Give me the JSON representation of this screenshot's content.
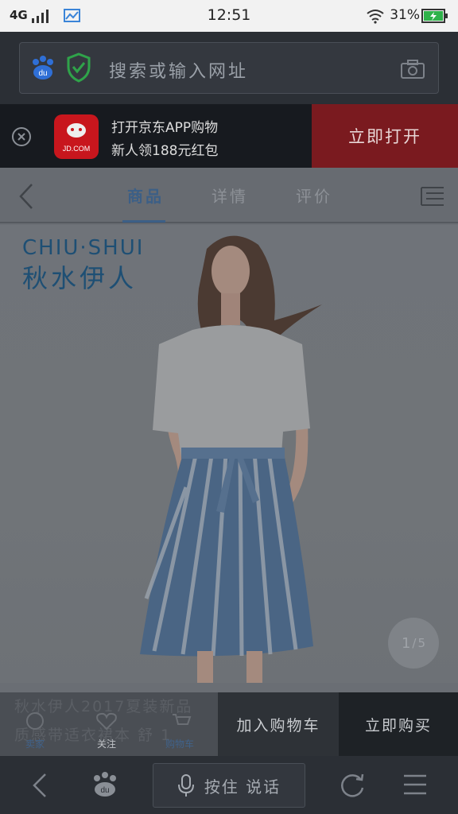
{
  "status": {
    "network": "4G",
    "time": "12:51",
    "battery": "31%"
  },
  "urlbar": {
    "placeholder": "搜索或输入网址"
  },
  "banner": {
    "line1": "打开京东APP购物",
    "line2": "新人领188元红包",
    "logo_text": "JD.COM",
    "open_label": "立即打开"
  },
  "tabs": [
    {
      "label": "商品"
    },
    {
      "label": "详情"
    },
    {
      "label": "评价"
    }
  ],
  "product": {
    "brand_en": "CHIU·SHUI",
    "brand_cn": "秋水伊人",
    "counter_current": "1",
    "counter_total": "5",
    "title_line1": "秋水伊人2017夏装新品",
    "title_line2": "质感带适衣裙本 舒 1"
  },
  "bottom": {
    "shop": "卖家",
    "follow": "关注",
    "cart": "购物车",
    "add_cart": "加入购物车",
    "buy_now": "立即购买"
  },
  "browser": {
    "voice_label": "按住 说话"
  },
  "colors": {
    "jd_red": "#c8161d",
    "accent_blue": "#3c5f86",
    "battery_green": "#2fb24a"
  }
}
